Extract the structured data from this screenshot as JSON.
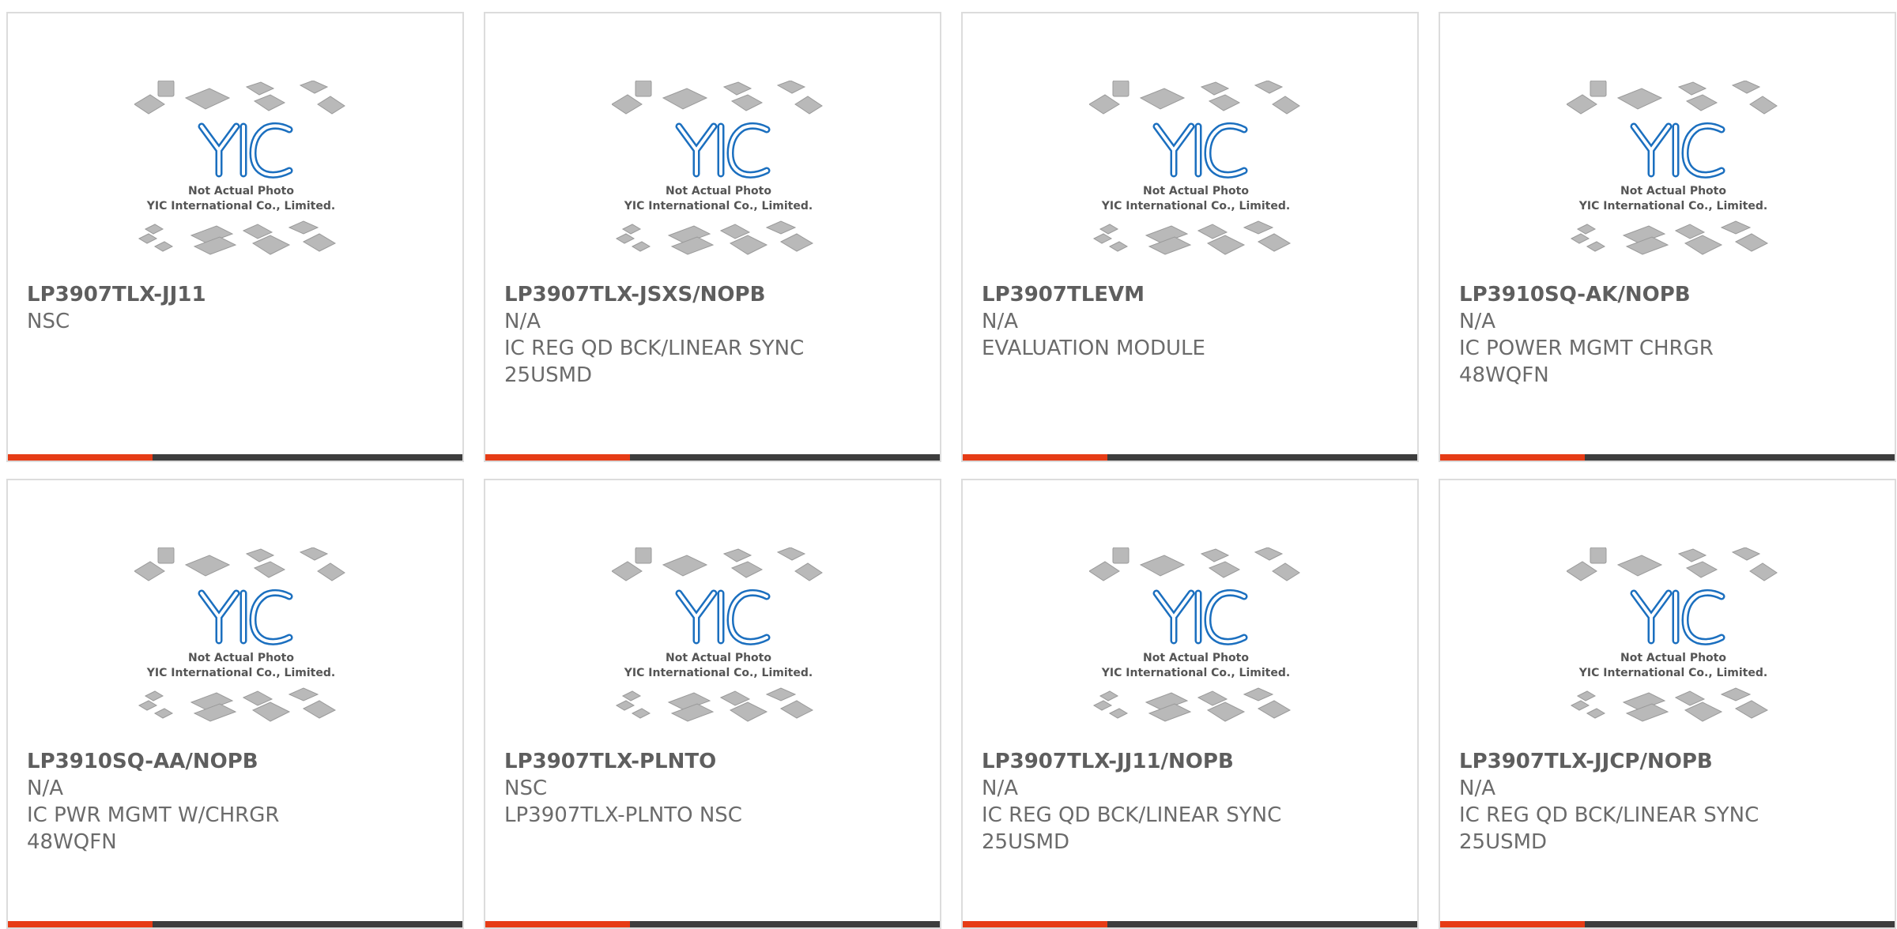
{
  "placeholder_image": {
    "icon": "yic-placeholder-icon",
    "line1": "Not Actual Photo",
    "line2": "YIC International Co., Limited.",
    "brand_color": "#1b6fbf"
  },
  "colors": {
    "accent": "#e63c16",
    "bar": "#3d3d3d",
    "text": "#6b6b6b",
    "border": "#dcdcdc"
  },
  "products": [
    {
      "part": "LP3907TLX-JJ11",
      "manufacturer": "NSC",
      "desc1": "",
      "desc2": ""
    },
    {
      "part": "LP3907TLX-JSXS/NOPB",
      "manufacturer": "N/A",
      "desc1": "IC REG QD BCK/LINEAR SYNC",
      "desc2": "25USMD"
    },
    {
      "part": "LP3907TLEVM",
      "manufacturer": "N/A",
      "desc1": "EVALUATION MODULE",
      "desc2": ""
    },
    {
      "part": "LP3910SQ-AK/NOPB",
      "manufacturer": "N/A",
      "desc1": "IC POWER MGMT CHRGR",
      "desc2": "48WQFN"
    },
    {
      "part": "LP3910SQ-AA/NOPB",
      "manufacturer": "N/A",
      "desc1": "IC PWR MGMT W/CHRGR",
      "desc2": "48WQFN"
    },
    {
      "part": "LP3907TLX-PLNTO",
      "manufacturer": "NSC",
      "desc1": "LP3907TLX-PLNTO NSC",
      "desc2": ""
    },
    {
      "part": "LP3907TLX-JJ11/NOPB",
      "manufacturer": "N/A",
      "desc1": "IC REG QD BCK/LINEAR SYNC",
      "desc2": "25USMD"
    },
    {
      "part": "LP3907TLX-JJCP/NOPB",
      "manufacturer": "N/A",
      "desc1": "IC REG QD BCK/LINEAR SYNC",
      "desc2": "25USMD"
    }
  ]
}
